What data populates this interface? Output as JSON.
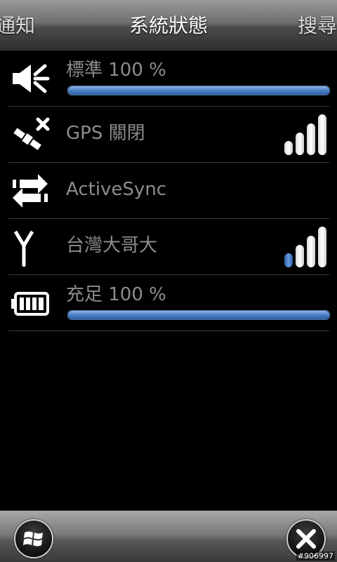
{
  "header": {
    "left_label": "通知",
    "title": "系統狀態",
    "right_label": "搜尋"
  },
  "rows": [
    {
      "icon": "speaker-icon",
      "label": "標準 100 %",
      "progress": 1.0
    },
    {
      "icon": "gps-satellite-off-icon",
      "label": "GPS 關閉",
      "signal_bars": 4,
      "signal_active": 0
    },
    {
      "icon": "activesync-arrows-icon",
      "label": "ActiveSync"
    },
    {
      "icon": "antenna-icon",
      "label": "台灣大哥大",
      "signal_bars": 4,
      "signal_active": 1
    },
    {
      "icon": "battery-icon",
      "label": "充足 100 %",
      "progress": 1.0
    }
  ],
  "footer": {
    "start_icon": "windows-flag-icon",
    "close_icon": "close-icon"
  },
  "watermark": "#906997",
  "colors": {
    "accent": "#4a7fc6",
    "label": "#8c8c8c",
    "background": "#000000"
  }
}
